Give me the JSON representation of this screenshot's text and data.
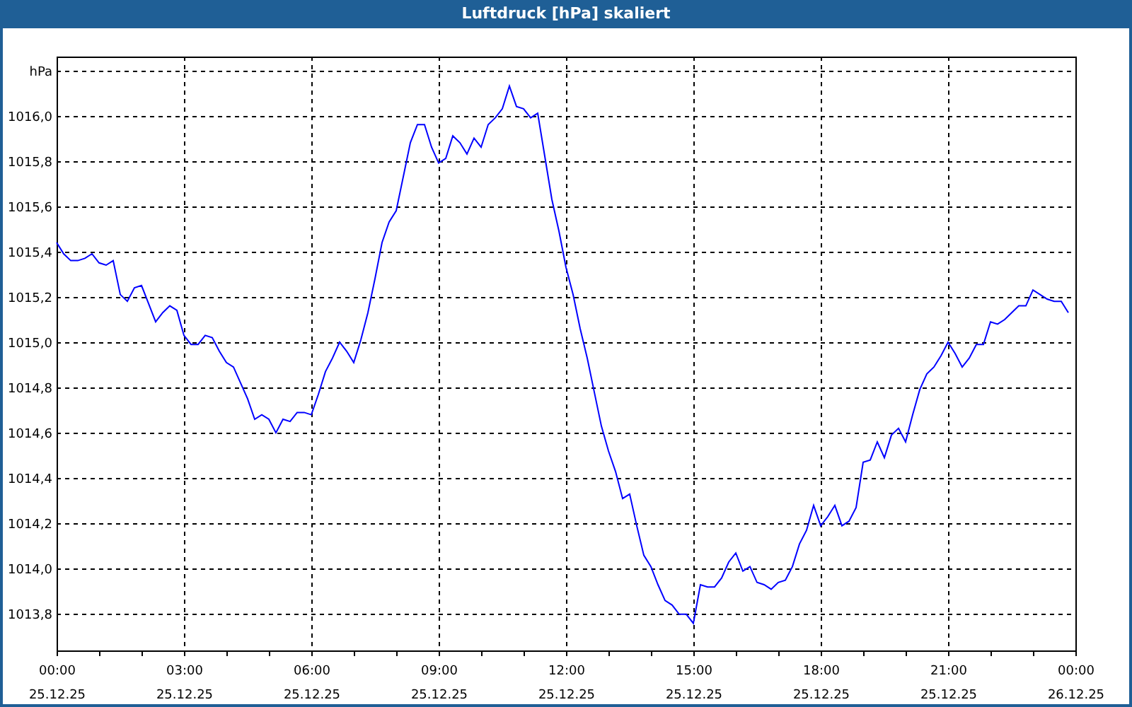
{
  "window": {
    "title": "Luftdruck [hPa] skaliert"
  },
  "chart": {
    "chart_data": {
      "type": "line",
      "grid": true,
      "ylim": [
        1013.64,
        1016.26
      ],
      "yticks": [
        {
          "value": 1013.8,
          "label": "1013,8"
        },
        {
          "value": 1014.0,
          "label": "1014,0"
        },
        {
          "value": 1014.2,
          "label": "1014,2"
        },
        {
          "value": 1014.4,
          "label": "1014,4"
        },
        {
          "value": 1014.6,
          "label": "1014,6"
        },
        {
          "value": 1014.8,
          "label": "1014,8"
        },
        {
          "value": 1015.0,
          "label": "1015,0"
        },
        {
          "value": 1015.2,
          "label": "1015,2"
        },
        {
          "value": 1015.4,
          "label": "1015,4"
        },
        {
          "value": 1015.6,
          "label": "1015,6"
        },
        {
          "value": 1015.8,
          "label": "1015,8"
        },
        {
          "value": 1016.0,
          "label": "1016,0"
        },
        {
          "value": 1016.2,
          "label": "hPa"
        }
      ],
      "categories": [
        "00:00\n25.12.25",
        null,
        null,
        null,
        null,
        null,
        null,
        null,
        null,
        null,
        null,
        null,
        null,
        null,
        null,
        null,
        null,
        null,
        "03:00\n25.12.25",
        null,
        null,
        null,
        null,
        null,
        null,
        null,
        null,
        null,
        null,
        null,
        null,
        null,
        null,
        null,
        null,
        null,
        "06:00\n25.12.25",
        null,
        null,
        null,
        null,
        null,
        null,
        null,
        null,
        null,
        null,
        null,
        null,
        null,
        null,
        null,
        null,
        null,
        "09:00\n25.12.25",
        null,
        null,
        null,
        null,
        null,
        null,
        null,
        null,
        null,
        null,
        null,
        null,
        null,
        null,
        null,
        null,
        null,
        "12:00\n25.12.25",
        null,
        null,
        null,
        null,
        null,
        null,
        null,
        null,
        null,
        null,
        null,
        null,
        null,
        null,
        null,
        null,
        null,
        "15:00\n25.12.25",
        null,
        null,
        null,
        null,
        null,
        null,
        null,
        null,
        null,
        null,
        null,
        null,
        null,
        null,
        null,
        null,
        null,
        "18:00\n25.12.25",
        null,
        null,
        null,
        null,
        null,
        null,
        null,
        null,
        null,
        null,
        null,
        null,
        null,
        null,
        null,
        null,
        null,
        "21:00\n25.12.25",
        null,
        null,
        null,
        null,
        null,
        null,
        null,
        null,
        null,
        null,
        null,
        null,
        null,
        null,
        null,
        null,
        null,
        "00:00\n26.12.25"
      ],
      "series": [
        {
          "color": "#0000ff",
          "values": [
            1015.44,
            1015.39,
            1015.36,
            1015.36,
            1015.37,
            1015.39,
            1015.35,
            1015.34,
            1015.36,
            1015.21,
            1015.18,
            1015.24,
            1015.25,
            1015.17,
            1015.09,
            1015.13,
            1015.16,
            1015.14,
            1015.03,
            1014.99,
            1014.99,
            1015.03,
            1015.02,
            1014.96,
            1014.91,
            1014.89,
            1014.82,
            1014.75,
            1014.66,
            1014.68,
            1014.66,
            1014.6,
            1014.66,
            1014.65,
            1014.69,
            1014.69,
            1014.68,
            1014.77,
            1014.87,
            1014.93,
            1015.0,
            1014.96,
            1014.91,
            1015.01,
            1015.13,
            1015.28,
            1015.44,
            1015.53,
            1015.58,
            1015.73,
            1015.88,
            1015.96,
            1015.96,
            1015.86,
            1015.79,
            1015.81,
            1015.91,
            1015.88,
            1015.83,
            1015.9,
            1015.86,
            1015.96,
            1015.99,
            1016.03,
            1016.13,
            1016.04,
            1016.03,
            1015.99,
            1016.01,
            1015.82,
            1015.63,
            1015.49,
            1015.33,
            1015.21,
            1015.06,
            1014.93,
            1014.78,
            1014.63,
            1014.52,
            1014.43,
            1014.31,
            1014.33,
            1014.19,
            1014.06,
            1014.01,
            1013.93,
            1013.86,
            1013.84,
            1013.8,
            1013.8,
            1013.76,
            1013.93,
            1013.92,
            1013.92,
            1013.96,
            1014.03,
            1014.07,
            1013.99,
            1014.01,
            1013.94,
            1013.93,
            1013.91,
            1013.94,
            1013.95,
            1014.01,
            1014.11,
            1014.17,
            1014.28,
            1014.19,
            1014.23,
            1014.28,
            1014.19,
            1014.21,
            1014.27,
            1014.47,
            1014.48,
            1014.56,
            1014.49,
            1014.59,
            1014.62,
            1014.56,
            1014.68,
            1014.79,
            1014.86,
            1014.89,
            1014.94,
            1015.0,
            1014.95,
            1014.89,
            1014.93,
            1014.99,
            1014.99,
            1015.09,
            1015.08,
            1015.1,
            1015.13,
            1015.16,
            1015.16,
            1015.23,
            1015.21,
            1015.19,
            1015.18,
            1015.18,
            1015.13,
            null
          ]
        }
      ]
    }
  }
}
